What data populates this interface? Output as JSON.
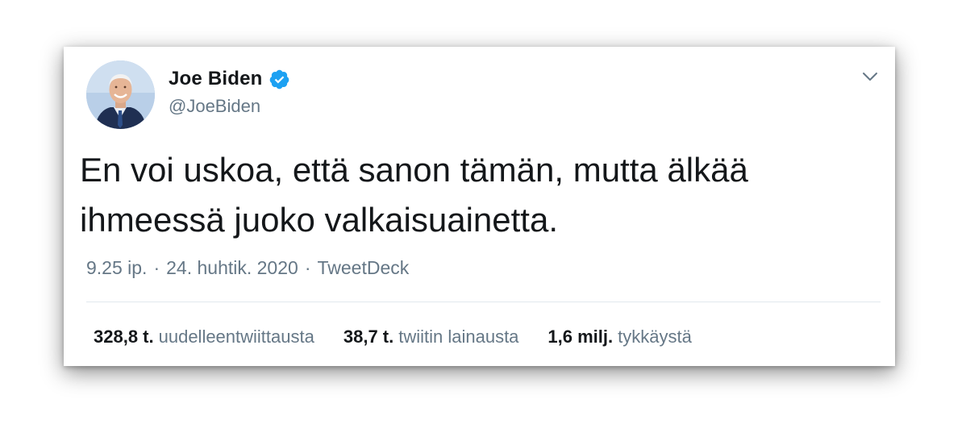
{
  "author": {
    "display_name": "Joe Biden",
    "handle": "@JoeBiden",
    "verified": true
  },
  "icons": {
    "verified": "verified-badge-icon",
    "menu": "chevron-down-icon"
  },
  "tweet": {
    "text": "En voi uskoa, että sanon tämän, mutta älkää ihmeessä juoko valkaisuainetta."
  },
  "meta": {
    "time": "9.25 ip.",
    "date": "24. huhtik. 2020",
    "source": "TweetDeck",
    "separator": "·"
  },
  "stats": {
    "retweets": {
      "count": "328,8 t.",
      "label": "uudelleentwiittausta"
    },
    "quotes": {
      "count": "38,7 t.",
      "label": "twiitin lainausta"
    },
    "likes": {
      "count": "1,6 milj.",
      "label": "tykkäystä"
    }
  },
  "colors": {
    "verified_blue": "#1da1f2",
    "text_primary": "#14171a",
    "text_secondary": "#657786",
    "divider": "#e1e8ed"
  }
}
